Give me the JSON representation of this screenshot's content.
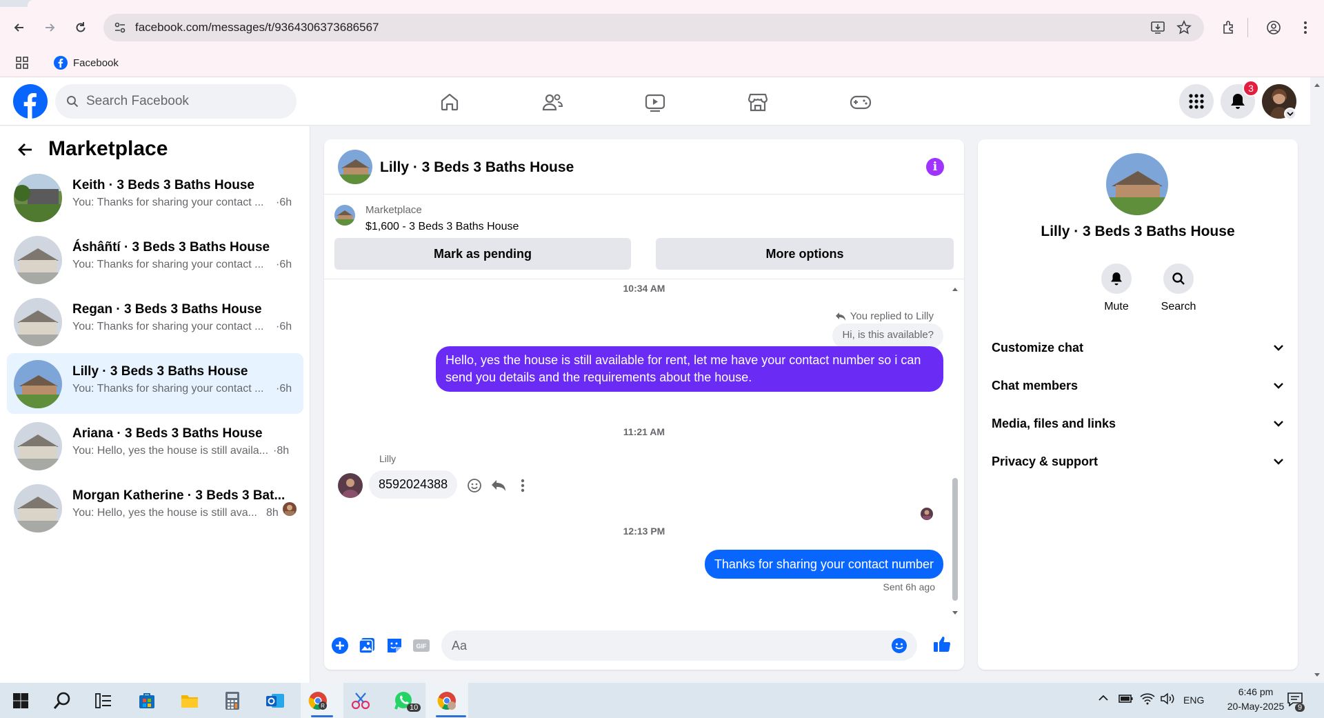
{
  "browser": {
    "url": "facebook.com/messages/t/9364306373686567",
    "bookmark_label": "Facebook"
  },
  "header": {
    "search_placeholder": "Search Facebook",
    "notification_count": "3"
  },
  "sidebar": {
    "title": "Marketplace",
    "conversations": [
      {
        "name": "Keith · 3 Beds 3 Baths House",
        "preview": "You: Thanks for sharing your contact ...",
        "time": "·6h"
      },
      {
        "name": "Áshâñtí · 3 Beds 3 Baths House",
        "preview": "You: Thanks for sharing your contact ...",
        "time": "·6h"
      },
      {
        "name": "Regan · 3 Beds 3 Baths House",
        "preview": "You: Thanks for sharing your contact ...",
        "time": "·6h"
      },
      {
        "name": "Lilly · 3 Beds 3 Baths House",
        "preview": "You: Thanks for sharing your contact ...",
        "time": "·6h"
      },
      {
        "name": "Ariana · 3 Beds 3 Baths House",
        "preview": "You: Hello, yes the house is still availa...",
        "time": "·8h"
      },
      {
        "name": "Morgan Katherine · 3 Beds 3 Bat...",
        "preview": "You: Hello, yes the house is still ava...",
        "time": "8h"
      }
    ]
  },
  "chat": {
    "title": "Lilly · 3 Beds 3 Baths House",
    "listing": {
      "source": "Marketplace",
      "title": "$1,600 - 3 Beds 3 Baths House",
      "pending_button": "Mark as pending",
      "more_button": "More options"
    },
    "messages": {
      "ts1": "10:34 AM",
      "replied_to": "You replied to Lilly",
      "quoted": "Hi, is this available?",
      "out1": "Hello, yes the house is still available for rent, let me have your contact number so i can send you details and the requirements about the house.",
      "ts2": "11:21 AM",
      "sender": "Lilly",
      "in1": "8592024388",
      "ts3": "12:13 PM",
      "out2": "Thanks for sharing your contact number",
      "status": "Sent 6h ago"
    },
    "composer_placeholder": "Aa"
  },
  "details": {
    "name": "Lilly · 3 Beds 3 Baths House",
    "mute_label": "Mute",
    "search_label": "Search",
    "sections": [
      "Customize chat",
      "Chat members",
      "Media, files and links",
      "Privacy & support"
    ]
  },
  "taskbar": {
    "lang": "ENG",
    "time": "6:46 pm",
    "date": "20-May-2025",
    "whatsapp_badge": "10",
    "notif_badge": "9"
  },
  "colors": {
    "fb_blue": "#0866ff",
    "bubble_purple": "#6a2cf5",
    "info_purple": "#a033ff",
    "badge_red": "#e41e3f"
  }
}
